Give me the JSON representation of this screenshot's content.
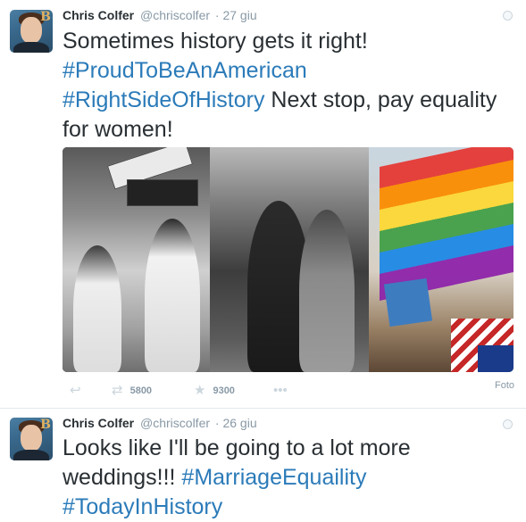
{
  "tweets": [
    {
      "fullname": "Chris Colfer",
      "username": "@chriscolfer",
      "time": "· 27 giu",
      "text_plain_1": "Sometimes history gets it right!",
      "hashtag_1": "#ProudToBeAnAmerican",
      "hashtag_2": "#RightSideOfHistory",
      "text_plain_2": " Next stop, pay equality for women!",
      "retweets": "5800",
      "favorites": "9300",
      "photo_label": "Foto"
    },
    {
      "fullname": "Chris Colfer",
      "username": "@chriscolfer",
      "time": "· 26 giu",
      "text_plain_1": "Looks like I'll be going to a lot more weddings!!! ",
      "hashtag_1": "#MarriageEquaility",
      "hashtag_2": "#TodayInHistory"
    }
  ],
  "avatar_letter": "B",
  "icons": {
    "reply": "reply-icon",
    "retweet": "retweet-icon",
    "favorite": "star-icon",
    "more": "more-icon",
    "globe": "globe-icon"
  },
  "colors": {
    "hashtag": "#2b7bb9",
    "meta": "#8899a6",
    "text": "#292f33"
  }
}
